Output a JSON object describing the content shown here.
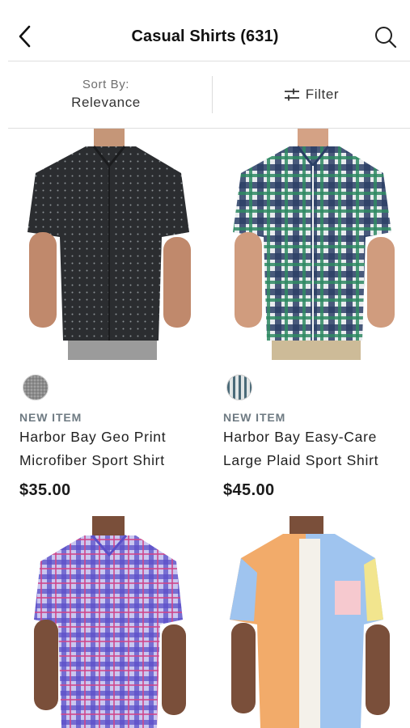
{
  "header": {
    "title": "Casual Shirts (631)",
    "back_icon": "chevron-left-icon",
    "search_icon": "search-icon"
  },
  "toolbar": {
    "sort_caption": "Sort By:",
    "sort_value": "Relevance",
    "filter_label": "Filter",
    "filter_icon": "sliders-icon"
  },
  "products": [
    {
      "badge": "NEW ITEM",
      "name_line1": "Harbor Bay Geo Print",
      "name_line2": "Microfiber Sport Shirt",
      "price": "$35.00",
      "swatch_color": "#8a8a8a"
    },
    {
      "badge": "NEW ITEM",
      "name_line1": "Harbor Bay Easy-Care",
      "name_line2": "Large Plaid Sport Shirt",
      "price": "$45.00",
      "swatch_color": "#9fb2b5"
    },
    {
      "shirt_color": "#8c86d6"
    },
    {
      "shirt_color": "#f2ab6a"
    }
  ],
  "colors": {
    "divider": "#dedede",
    "badge": "#6e7a82",
    "text": "#1a1a1a"
  }
}
